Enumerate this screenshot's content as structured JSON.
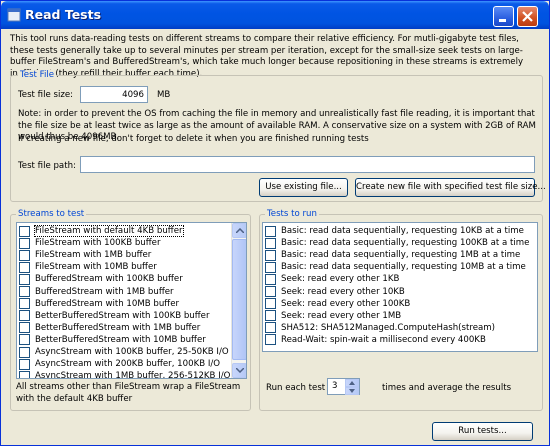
{
  "window": {
    "title": "Read Tests"
  },
  "intro": "This tool runs data-reading tests on different streams to compare their relative efficiency.  For mutli-gigabyte test files, these tests generally take up to several minutes per stream per iteration, except for the small-size seek tests on large-buffer FileStream's and BufferedStream's, which take much longer because repositioning in these streams is extremely inefficient (they refill their buffer each time).",
  "test_file": {
    "legend": "Test File",
    "size_label": "Test file size:",
    "size_value": "4096",
    "size_unit": "MB",
    "note": "Note: in order to prevent the OS from caching the file in memory and unrealistically fast file reading, it is important that the file size be at least twice as large as the amount of available RAM.  A conservative size on a system with 2GB of RAM would thus be 4096MB.",
    "create_note": "If creating a new file, don't forget to delete it when you are finished running tests",
    "path_label": "Test file path:",
    "path_value": "",
    "use_existing_label": "Use existing file...",
    "create_new_label": "Create new file with specified test file size..."
  },
  "streams": {
    "legend": "Streams to test",
    "items": [
      "FileStream with default 4KB buffer",
      "FileStream with 100KB buffer",
      "FileStream with 1MB buffer",
      "FileStream with 10MB buffer",
      "BufferedStream with 100KB buffer",
      "BufferedStream with 1MB buffer",
      "BufferedStream with 10MB buffer",
      "BetterBufferedStream with 100KB buffer",
      "BetterBufferedStream with 1MB buffer",
      "BetterBufferedStream with 10MB buffer",
      "AsyncStream with 100KB buffer, 25-50KB I/O",
      "AsyncStream with 200KB buffer, 100KB I/O",
      "AsyncStream with 1MB buffer, 256-512KB I/O"
    ],
    "footnote": "All streams other than FileStream wrap a FileStream with the default 4KB buffer"
  },
  "tests": {
    "legend": "Tests to run",
    "items": [
      "Basic: read data sequentially, requesting 10KB at a time",
      "Basic: read data sequentially, requesting 100KB at a time",
      "Basic: read data sequentially, requesting 1MB at a time",
      "Basic: read data sequentially, requesting 10MB at a time",
      "Seek: read every other 1KB",
      "Seek: read every other 10KB",
      "Seek: read every other 100KB",
      "Seek: read every other 1MB",
      "SHA512: SHA512Managed.ComputeHash(stream)",
      "Read-Wait: spin-wait a millisecond every 400KB"
    ],
    "run_each_label": "Run each test",
    "iterations": "3",
    "times_label": "times and average the results"
  },
  "run_button_label": "Run tests..."
}
